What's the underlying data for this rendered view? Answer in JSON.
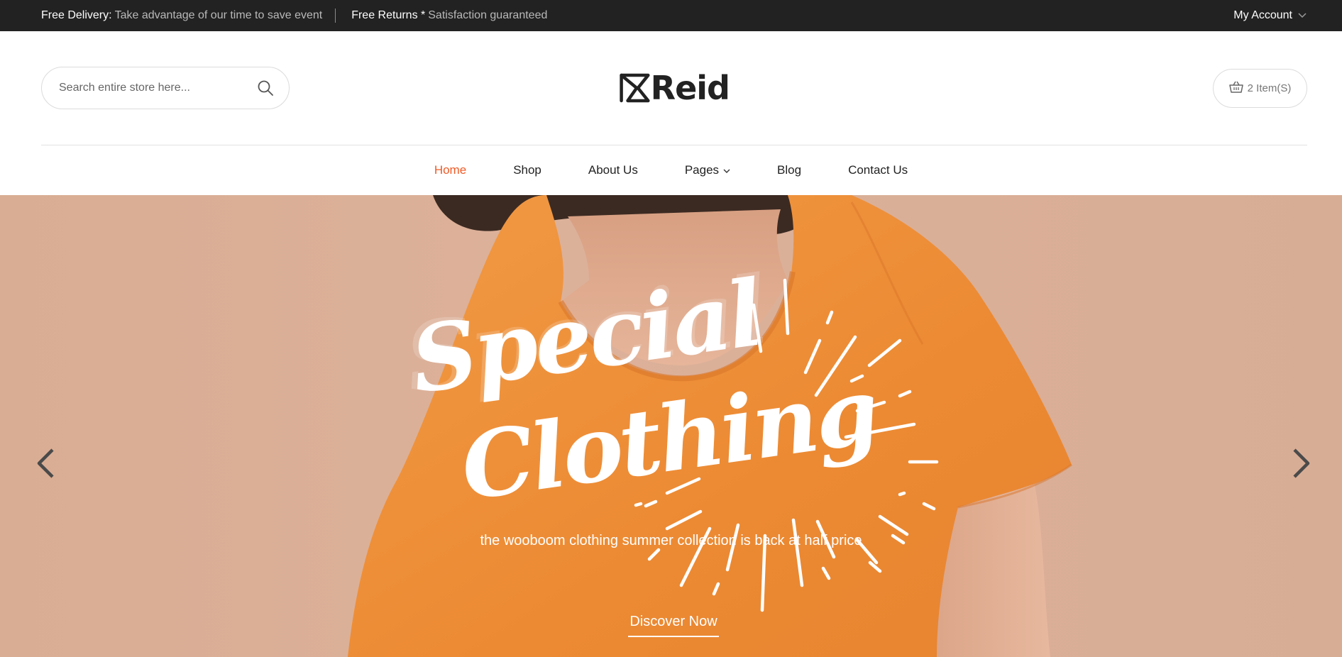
{
  "topbar": {
    "delivery_title": "Free Delivery:",
    "delivery_text": "Take advantage of our time to save event",
    "returns_title": "Free Returns *",
    "returns_text": "Satisfaction guaranteed",
    "account_label": "My Account"
  },
  "header": {
    "search_placeholder": "Search entire store here...",
    "logo_text": "Reid",
    "cart_label": "2 Item(S)"
  },
  "nav": {
    "items": [
      {
        "label": "Home",
        "active": true
      },
      {
        "label": "Shop"
      },
      {
        "label": "About Us"
      },
      {
        "label": "Pages",
        "has_dropdown": true
      },
      {
        "label": "Blog"
      },
      {
        "label": "Contact Us"
      }
    ]
  },
  "hero": {
    "headline_line1": "Special",
    "headline_line2": "Clothing",
    "subtitle": "the wooboom clothing summer collection is back at half price",
    "cta_label": "Discover Now"
  },
  "colors": {
    "topbar_bg": "#222222",
    "accent": "#ef5b27",
    "hero_bg": "#d9ad93",
    "shirt": "#f0903a"
  },
  "icons": {
    "search": "search-icon",
    "cart": "basket-icon",
    "account_dropdown": "chevron-down-icon",
    "prev": "chevron-left-icon",
    "next": "chevron-right-icon"
  }
}
